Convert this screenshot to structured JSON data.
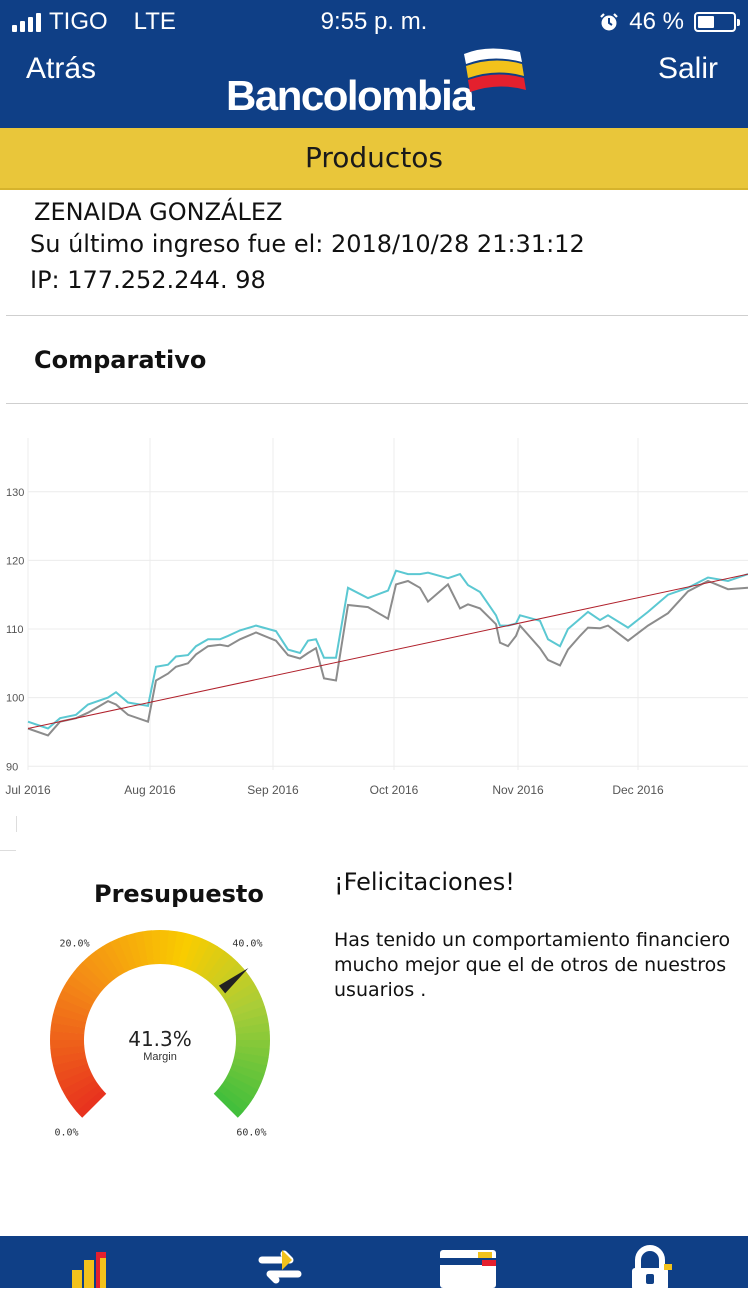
{
  "status_bar": {
    "carrier": "TIGO",
    "network": "LTE",
    "time": "9:55 p. m.",
    "battery": "46 %",
    "battery_level": 0.46
  },
  "header": {
    "back_label": "Atrás",
    "brand": "Bancolombia",
    "exit_label": "Salir"
  },
  "section": {
    "title": "Productos"
  },
  "user": {
    "name": "ZENAIDA GONZÁLEZ",
    "last_login": "Su último ingreso fue el: 2018/10/28 21:31:12",
    "ip": "IP: 177.252.244. 98"
  },
  "comparativo": {
    "title": "Comparativo"
  },
  "chart_data": {
    "type": "line",
    "title": "",
    "xlabel": "",
    "ylabel": "",
    "x_ticks": [
      "Jul 2016",
      "Aug 2016",
      "Sep 2016",
      "Oct 2016",
      "Nov 2016",
      "Dec 2016"
    ],
    "y_ticks": [
      90,
      100,
      110,
      120,
      130
    ],
    "ylim": [
      88,
      139
    ],
    "xlim": [
      0,
      180
    ],
    "grid": true,
    "series": [
      {
        "color": "#5bc8d2",
        "x": [
          0,
          5,
          8,
          12,
          15,
          20,
          22,
          25,
          30,
          32,
          35,
          37,
          40,
          42,
          45,
          48,
          50,
          53,
          57,
          62,
          65,
          68,
          70,
          72,
          74,
          77,
          80,
          85,
          90,
          92,
          95,
          98,
          100,
          105,
          108,
          110,
          113,
          117,
          118,
          120,
          122,
          123,
          128,
          130,
          133,
          135,
          138,
          140,
          143,
          145,
          150,
          155,
          160,
          165,
          170,
          175,
          180
        ],
        "y": [
          96.5,
          95.5,
          97,
          97.5,
          99,
          100,
          100.8,
          99.3,
          98.8,
          104.5,
          104.8,
          106,
          106.2,
          107.5,
          108.5,
          108.5,
          109,
          109.8,
          110.5,
          109.7,
          107,
          106.5,
          108.3,
          108.5,
          105.8,
          105.8,
          116,
          114.5,
          115.6,
          118.5,
          118,
          118,
          118.2,
          117.4,
          118,
          116.4,
          115.4,
          112,
          110.5,
          110.5,
          110.8,
          112,
          111.2,
          108.5,
          107.5,
          110,
          111.5,
          112.5,
          111.3,
          112,
          110.2,
          112.5,
          115,
          116,
          117.5,
          117,
          118
        ]
      },
      {
        "color": "#8c8c8c",
        "x": [
          0,
          5,
          8,
          12,
          15,
          20,
          22,
          25,
          30,
          32,
          35,
          37,
          40,
          42,
          45,
          48,
          50,
          53,
          57,
          62,
          65,
          68,
          70,
          72,
          74,
          77,
          80,
          85,
          90,
          92,
          95,
          98,
          100,
          105,
          108,
          110,
          113,
          117,
          118,
          120,
          122,
          123,
          128,
          130,
          133,
          135,
          138,
          140,
          143,
          145,
          150,
          155,
          160,
          165,
          170,
          175,
          180
        ],
        "y": [
          95.5,
          94.5,
          96.5,
          97,
          97.8,
          99.5,
          99,
          97.5,
          96.5,
          102.5,
          103.5,
          104.5,
          105,
          106.3,
          107.5,
          107.7,
          107.5,
          108.5,
          109.5,
          108.3,
          106.2,
          105.7,
          106.5,
          107.2,
          102.8,
          102.5,
          113.5,
          113.2,
          111.5,
          116.5,
          117,
          116,
          114,
          116.5,
          113,
          113.6,
          113,
          110.7,
          108,
          107.5,
          109,
          110.5,
          107.2,
          105.5,
          104.7,
          107,
          109,
          110.2,
          110.1,
          110.5,
          108.3,
          110.5,
          112.3,
          115.5,
          117,
          115.8,
          116
        ]
      },
      {
        "color": "#b0202b",
        "x": [
          0,
          180
        ],
        "y": [
          95.5,
          118
        ]
      }
    ]
  },
  "budget": {
    "title": "Presupuesto",
    "value_text": "41.3%",
    "value": 41.3,
    "min": 0,
    "max": 60,
    "sub_label": "Margin",
    "tick_labels": [
      "0.0%",
      "20.0%",
      "40.0%",
      "60.0%"
    ]
  },
  "congrats": {
    "title": "¡Felicitaciones!",
    "text": "Has tenido un comportamiento financiero mucho mejor que el de otros de nuestros usuarios ."
  },
  "bottom_nav": {
    "items": [
      "products-icon",
      "transfer-icon",
      "payments-icon",
      "security-lock-icon"
    ]
  },
  "colors": {
    "header_blue": "#0f3f86",
    "section_yellow": "#e9c63a"
  }
}
